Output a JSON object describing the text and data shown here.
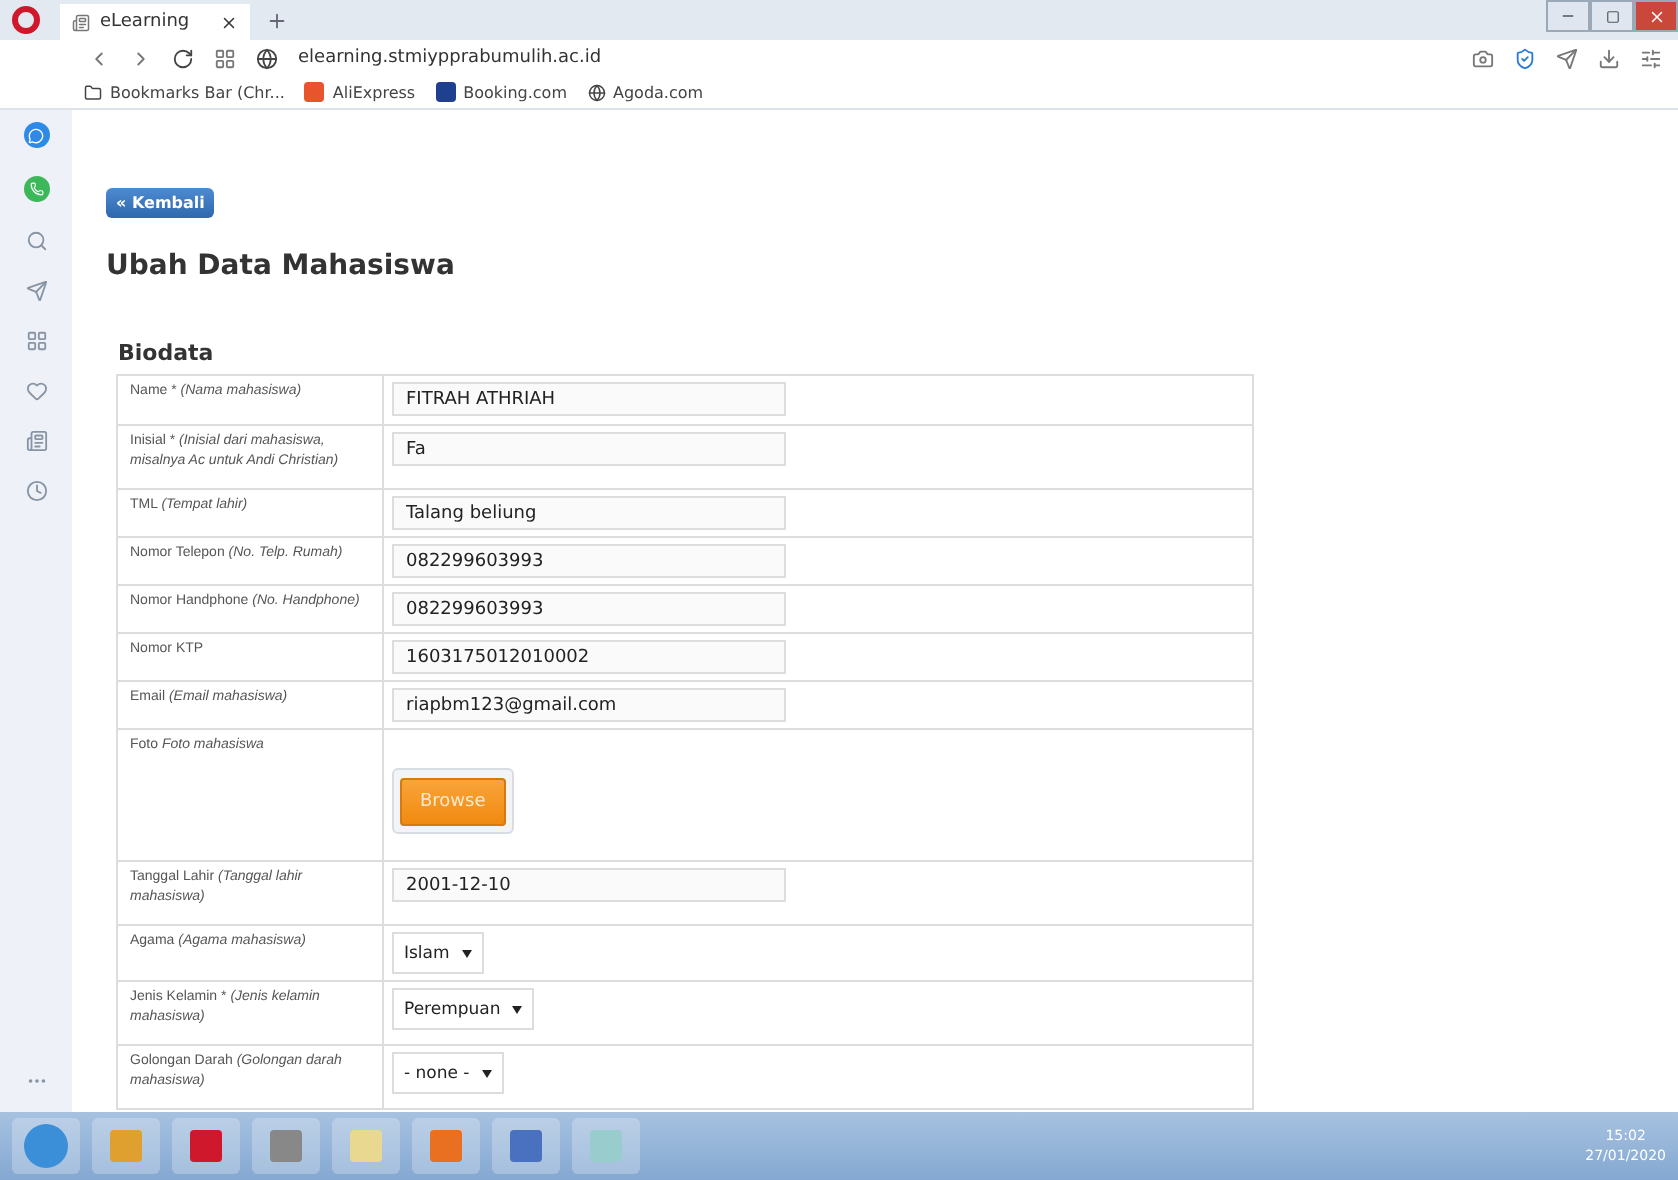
{
  "browser": {
    "tabs": [
      {
        "title": "eLearning",
        "selected": true
      }
    ],
    "address": "elearning.stmiypprabumulih.ac.id",
    "bookmarks": [
      {
        "kind": "folder",
        "label": "Bookmarks Bar (Chr..."
      },
      {
        "kind": "site",
        "label": "AliExpress",
        "color": "#e8542c"
      },
      {
        "kind": "site",
        "label": "Booking.com",
        "color": "#1f3f8f"
      },
      {
        "kind": "agoda",
        "label": "Agoda.com"
      }
    ]
  },
  "page": {
    "back_button": "« Kembali",
    "title": "Ubah Data Mahasiswa",
    "section": "Biodata",
    "fields": [
      {
        "kind": "text",
        "label": "Name *",
        "hint": "(Nama mahasiswa)",
        "value": "FITRAH ATHRIAH"
      },
      {
        "kind": "text",
        "label": "Inisial *",
        "hint": "(Inisial dari mahasiswa, misalnya Ac untuk Andi Christian)",
        "value": "Fa"
      },
      {
        "kind": "text",
        "label": "TML",
        "hint": "(Tempat lahir)",
        "value": "Talang beliung"
      },
      {
        "kind": "text",
        "label": "Nomor Telepon",
        "hint": "(No. Telp. Rumah)",
        "value": "082299603993"
      },
      {
        "kind": "text",
        "label": "Nomor Handphone",
        "hint": "(No. Handphone)",
        "value": "082299603993"
      },
      {
        "kind": "text",
        "label": "Nomor KTP",
        "value": "1603175012010002"
      },
      {
        "kind": "text",
        "label": "Email",
        "hint": "(Email mahasiswa)",
        "value": "riapbm123@gmail.com"
      },
      {
        "kind": "file",
        "label": "Foto",
        "hint": "Foto mahasiswa",
        "button": "Browse"
      },
      {
        "kind": "text",
        "label": "Tanggal Lahir",
        "hint": "(Tanggal lahir mahasiswa)",
        "value": "2001-12-10"
      },
      {
        "kind": "select",
        "label": "Agama",
        "hint": "(Agama mahasiswa)",
        "value": "Islam"
      },
      {
        "kind": "select",
        "label": "Jenis Kelamin *",
        "hint": "(Jenis kelamin mahasiswa)",
        "value": "Perempuan"
      },
      {
        "kind": "select",
        "label": "Golongan Darah",
        "hint": "(Golongan darah mahasiswa)",
        "value": "- none -"
      }
    ]
  },
  "taskbar": {
    "time": "15:02",
    "date": "27/01/2020"
  }
}
